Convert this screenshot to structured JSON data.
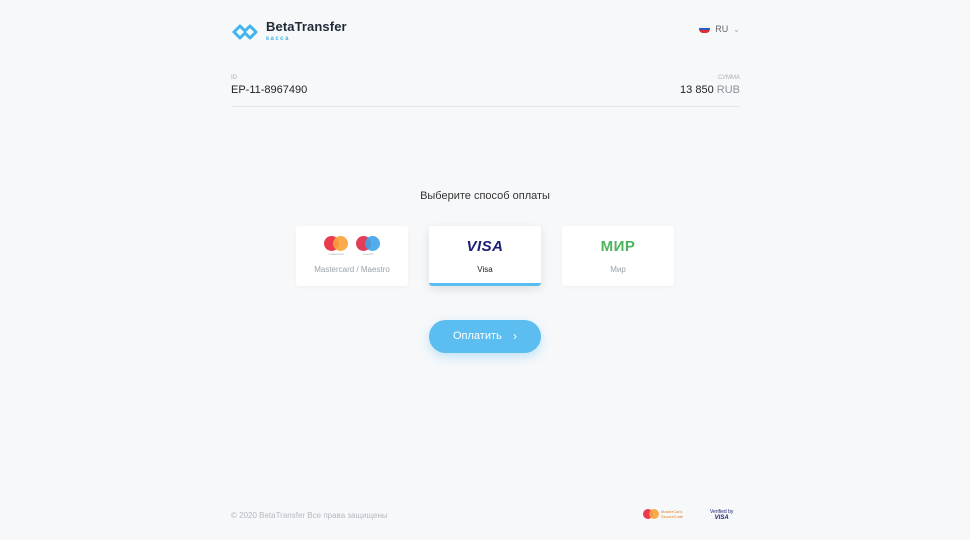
{
  "brand": {
    "name": "BetaTransfer",
    "subtitle": "касса",
    "logo_icon": "infinity-chain-icon",
    "accent": "#41b4ec"
  },
  "language": {
    "code": "RU",
    "flag_icon": "russia-flag-icon",
    "chevron_icon": "chevron-down-icon"
  },
  "order": {
    "id_label": "ID",
    "id_value": "EP-11-8967490",
    "amount_label": "СУММА",
    "amount_value": "13 850",
    "currency": "RUB"
  },
  "payment": {
    "title": "Выберите способ оплаты",
    "methods": [
      {
        "label": "Mastercard / Maestro",
        "icon": "mastercard-maestro-icon",
        "captions": [
          "mastercard",
          "maestro"
        ],
        "selected": false
      },
      {
        "label": "Visa",
        "icon": "visa-icon",
        "logo_text": "VISA",
        "selected": true
      },
      {
        "label": "Мир",
        "icon": "mir-icon",
        "logo_text": "МИР",
        "selected": false
      }
    ],
    "pay_button": "Оплатить",
    "pay_button_icon": "chevron-right-icon",
    "pay_button_color": "#5bbdf0"
  },
  "footer": {
    "copyright": "© 2020 BetaTransfer Все права защищены",
    "badges": {
      "mastercard_line1": "MasterCard.",
      "mastercard_line2": "SecureCode",
      "visa_line1": "Verified by",
      "visa_line2": "VISA"
    }
  }
}
